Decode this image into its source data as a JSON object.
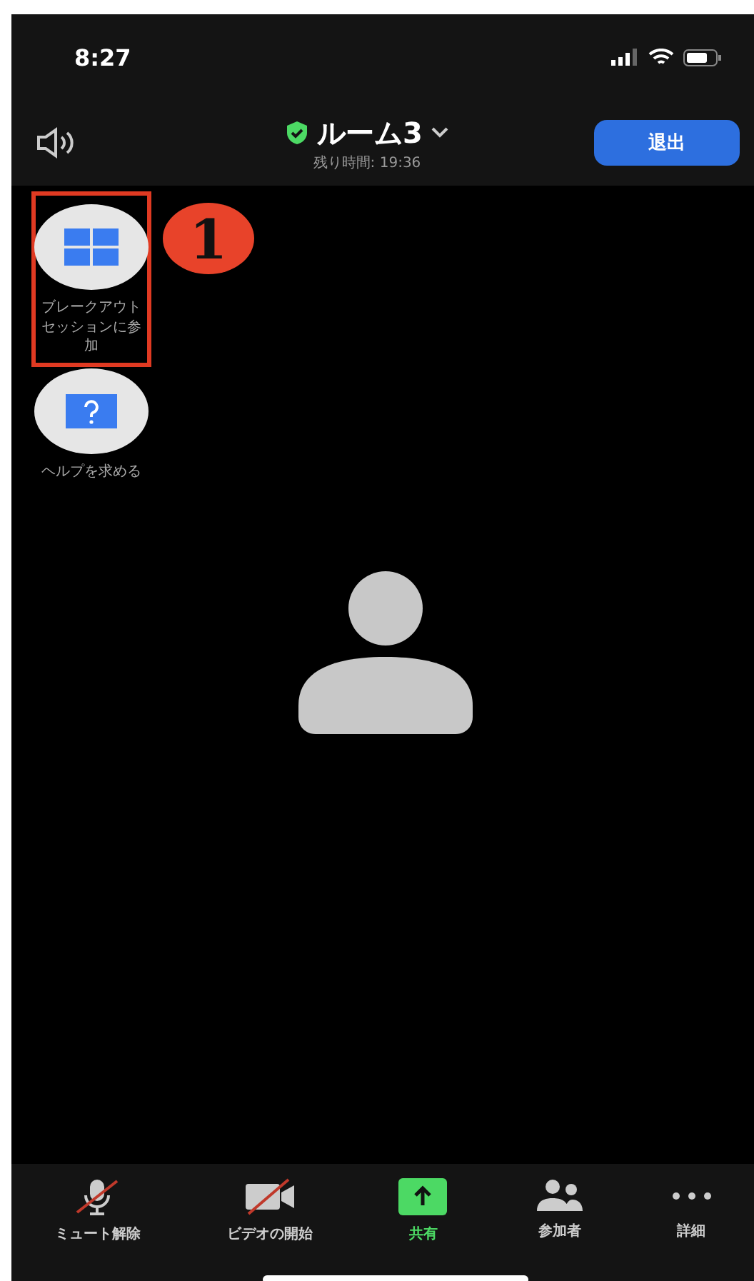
{
  "status_bar": {
    "time": "8:27"
  },
  "header": {
    "room": "ルーム3",
    "remaining": "残り時間: 19:36",
    "leave_button": "退出"
  },
  "side_actions": [
    {
      "kind": "breakout",
      "label": "ブレークアウトセッションに参加",
      "highlighted": true
    },
    {
      "kind": "help",
      "label": "ヘルプを求める",
      "highlighted": false
    }
  ],
  "annotation": {
    "label": "1"
  },
  "toolbar": [
    {
      "kind": "mic",
      "label": "ミュート解除",
      "off": true
    },
    {
      "kind": "video",
      "label": "ビデオの開始",
      "off": true
    },
    {
      "kind": "share",
      "label": "共有",
      "off": false
    },
    {
      "kind": "participants",
      "label": "参加者",
      "off": false
    },
    {
      "kind": "more",
      "label": "詳細",
      "off": false
    }
  ]
}
